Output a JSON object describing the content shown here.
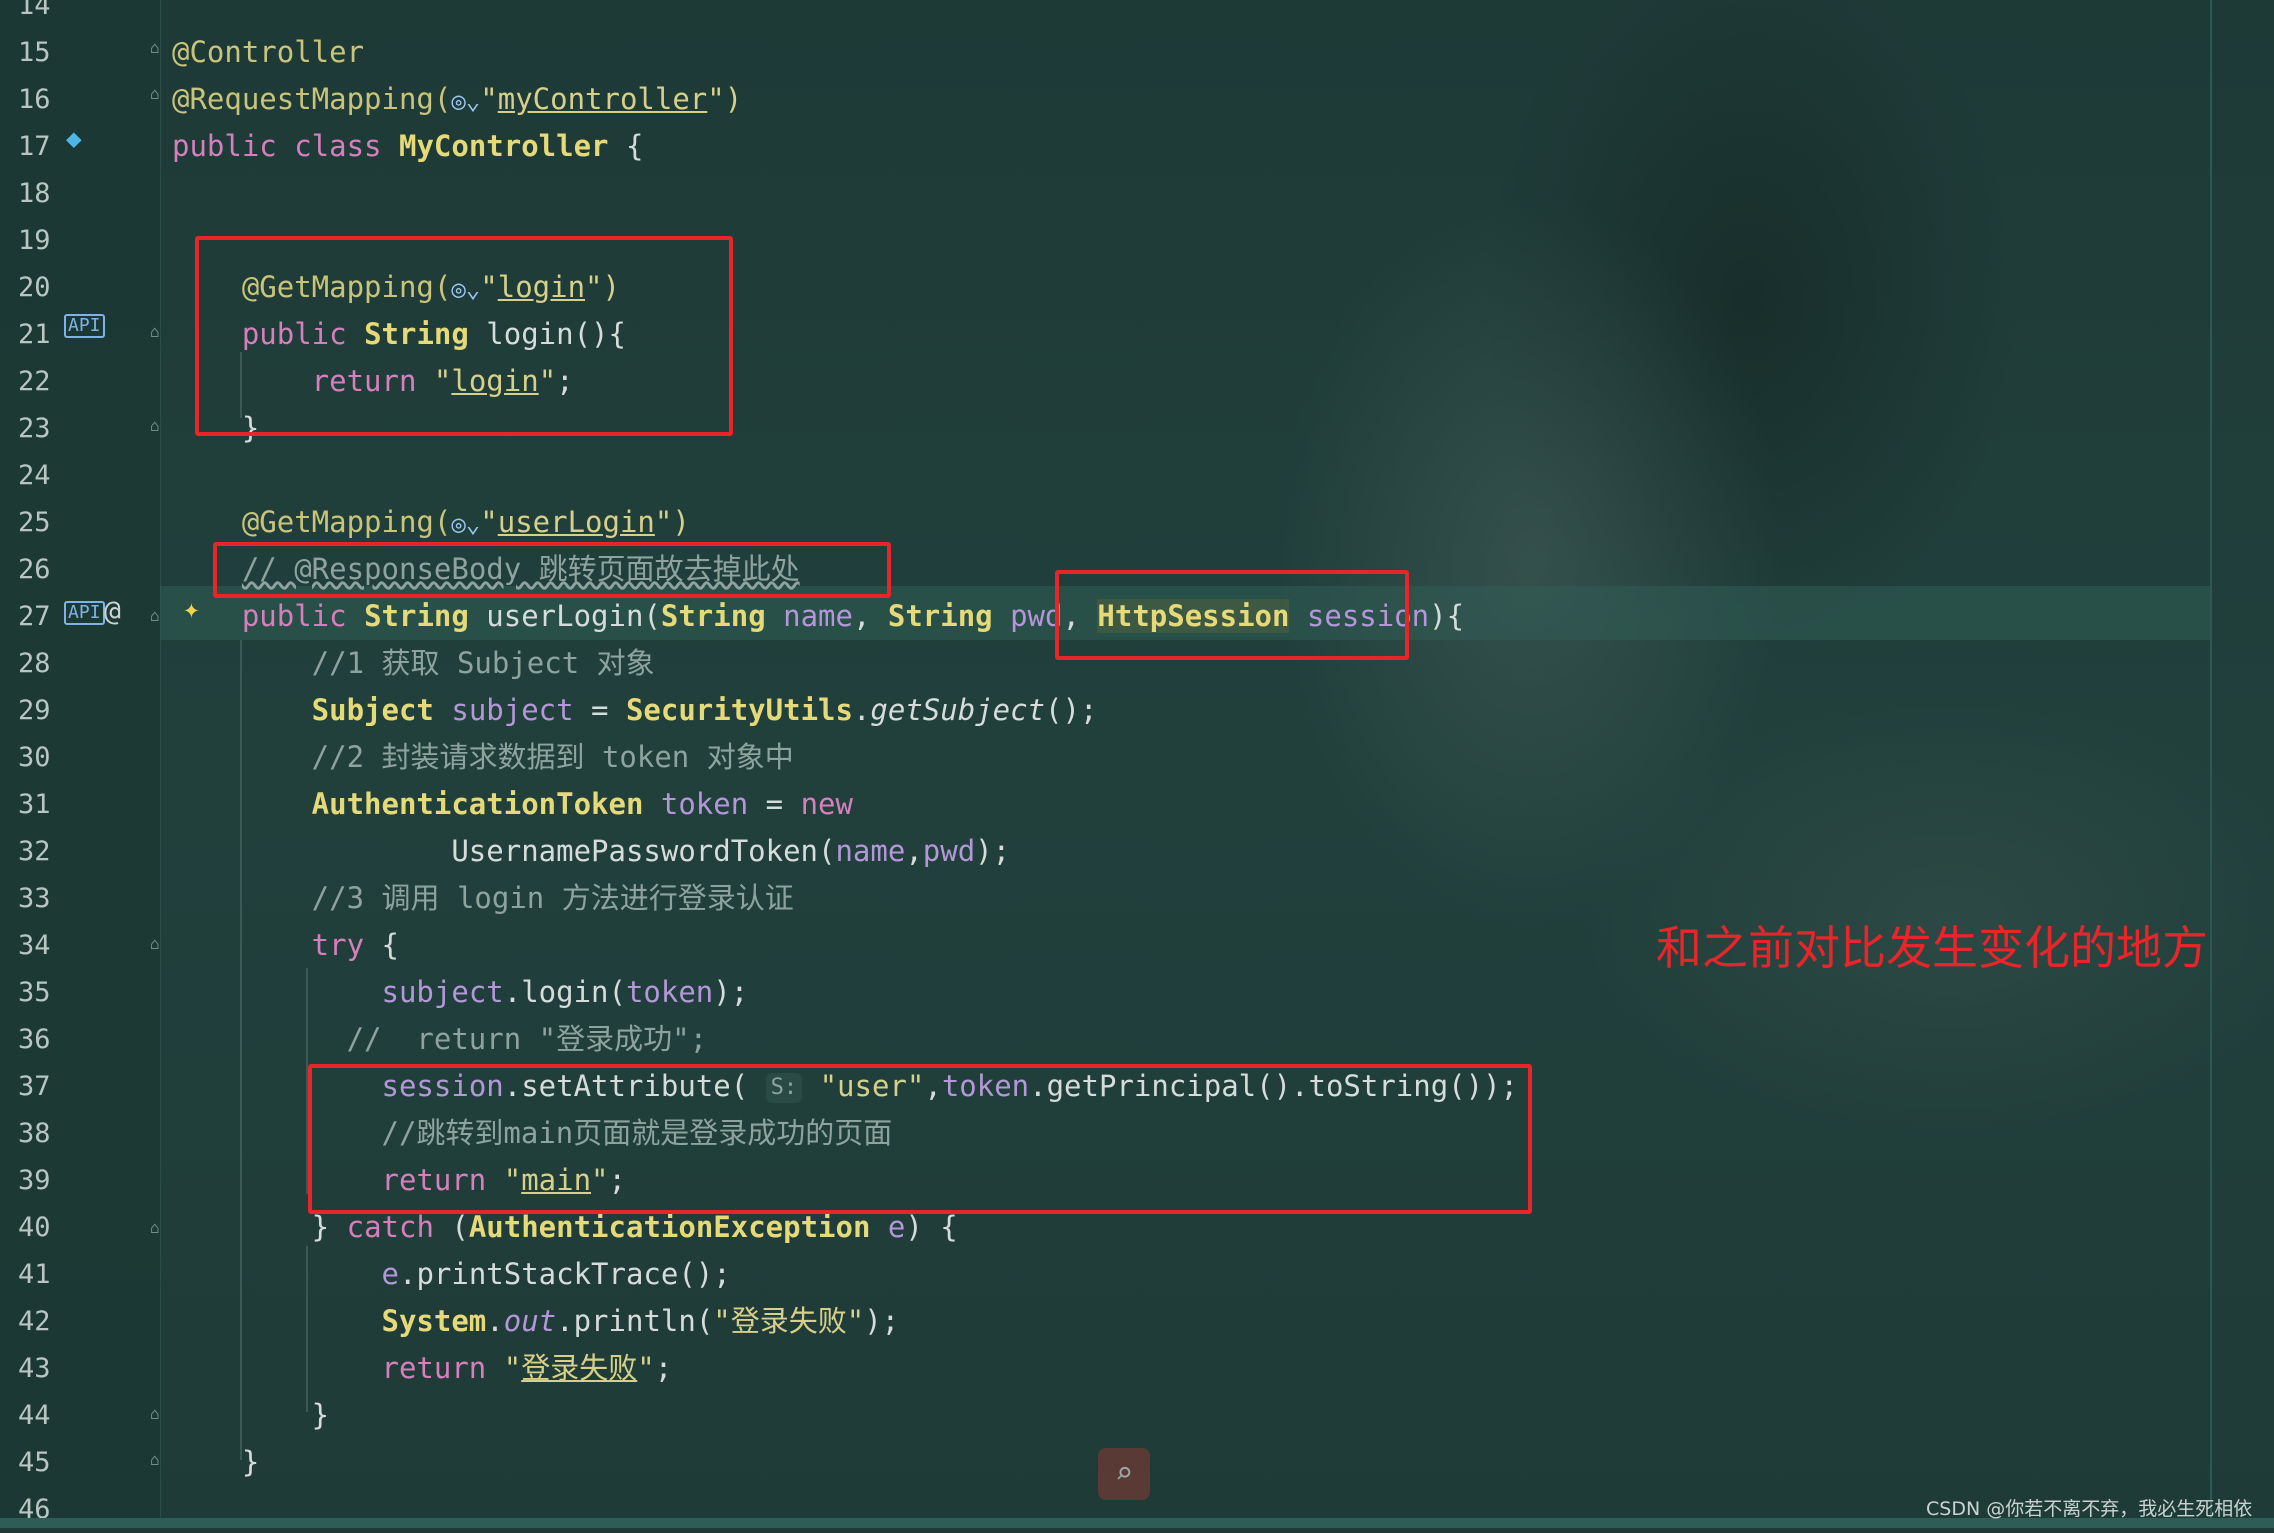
{
  "lines": [
    {
      "n": "14",
      "tokens": []
    },
    {
      "n": "15",
      "tokens": [
        {
          "t": "@Controller",
          "c": "annot"
        }
      ]
    },
    {
      "n": "16",
      "tokens": [
        {
          "t": "@RequestMapping(",
          "c": "annot"
        },
        {
          "t": "◎⌄",
          "c": "globe"
        },
        {
          "t": "\"",
          "c": "str"
        },
        {
          "t": "myController",
          "c": "strl"
        },
        {
          "t": "\")",
          "c": "str"
        }
      ]
    },
    {
      "n": "17",
      "tokens": [
        {
          "t": "public ",
          "c": "kw"
        },
        {
          "t": "class ",
          "c": "kw"
        },
        {
          "t": "MyController",
          "c": "cls"
        },
        {
          "t": " {",
          "c": "plain"
        }
      ]
    },
    {
      "n": "18",
      "tokens": []
    },
    {
      "n": "19",
      "tokens": []
    },
    {
      "n": "20",
      "tokens": [
        {
          "t": "    @GetMapping(",
          "c": "annot"
        },
        {
          "t": "◎⌄",
          "c": "globe"
        },
        {
          "t": "\"",
          "c": "str"
        },
        {
          "t": "login",
          "c": "strl"
        },
        {
          "t": "\")",
          "c": "str"
        }
      ]
    },
    {
      "n": "21",
      "tokens": [
        {
          "t": "    public ",
          "c": "kw"
        },
        {
          "t": "String ",
          "c": "cls"
        },
        {
          "t": "login(){",
          "c": "plain"
        }
      ]
    },
    {
      "n": "22",
      "tokens": [
        {
          "t": "        return ",
          "c": "kw"
        },
        {
          "t": "\"",
          "c": "str"
        },
        {
          "t": "login",
          "c": "strl"
        },
        {
          "t": "\"",
          "c": "str"
        },
        {
          "t": ";",
          "c": "plain"
        }
      ]
    },
    {
      "n": "23",
      "tokens": [
        {
          "t": "    }",
          "c": "plain"
        }
      ]
    },
    {
      "n": "24",
      "tokens": []
    },
    {
      "n": "25",
      "tokens": [
        {
          "t": "    @GetMapping(",
          "c": "annot"
        },
        {
          "t": "◎⌄",
          "c": "globe"
        },
        {
          "t": "\"",
          "c": "str"
        },
        {
          "t": "userLogin",
          "c": "strl"
        },
        {
          "t": "\")",
          "c": "str"
        }
      ]
    },
    {
      "n": "26",
      "tokens": [
        {
          "t": "    ",
          "c": "plain"
        },
        {
          "t": "// @ResponseBody 跳转页面故去掉此处",
          "c": "cmu"
        }
      ]
    },
    {
      "n": "27",
      "tokens": [
        {
          "t": "    public ",
          "c": "kw"
        },
        {
          "t": "String ",
          "c": "cls"
        },
        {
          "t": "userLogin(",
          "c": "plain"
        },
        {
          "t": "String ",
          "c": "cls"
        },
        {
          "t": "name",
          "c": "var"
        },
        {
          "t": ", ",
          "c": "plain"
        },
        {
          "t": "String ",
          "c": "cls"
        },
        {
          "t": "pwd",
          "c": "var"
        },
        {
          "t": ", ",
          "c": "plain"
        },
        {
          "t": "HttpSession",
          "c": "cls hlbox"
        },
        {
          "t": " session",
          "c": "var"
        },
        {
          "t": "){",
          "c": "plain"
        }
      ]
    },
    {
      "n": "28",
      "tokens": [
        {
          "t": "        //1 获取 Subject 对象",
          "c": "cm"
        }
      ]
    },
    {
      "n": "29",
      "tokens": [
        {
          "t": "        Subject ",
          "c": "cls"
        },
        {
          "t": "subject",
          "c": "var"
        },
        {
          "t": " = ",
          "c": "plain"
        },
        {
          "t": "SecurityUtils",
          "c": "cls"
        },
        {
          "t": ".",
          "c": "plain"
        },
        {
          "t": "getSubject",
          "c": "plain it"
        },
        {
          "t": "();",
          "c": "plain"
        }
      ]
    },
    {
      "n": "30",
      "tokens": [
        {
          "t": "        //2 封装请求数据到 token 对象中",
          "c": "cm"
        }
      ]
    },
    {
      "n": "31",
      "tokens": [
        {
          "t": "        AuthenticationToken ",
          "c": "cls"
        },
        {
          "t": "token",
          "c": "var"
        },
        {
          "t": " = ",
          "c": "plain"
        },
        {
          "t": "new",
          "c": "kw"
        }
      ]
    },
    {
      "n": "32",
      "tokens": [
        {
          "t": "                UsernamePasswordToken(",
          "c": "plain"
        },
        {
          "t": "name",
          "c": "var"
        },
        {
          "t": ",",
          "c": "plain"
        },
        {
          "t": "pwd",
          "c": "var"
        },
        {
          "t": ");",
          "c": "plain"
        }
      ]
    },
    {
      "n": "33",
      "tokens": [
        {
          "t": "        //3 调用 login 方法进行登录认证",
          "c": "cm"
        }
      ]
    },
    {
      "n": "34",
      "tokens": [
        {
          "t": "        try ",
          "c": "kw"
        },
        {
          "t": "{",
          "c": "plain"
        }
      ]
    },
    {
      "n": "35",
      "tokens": [
        {
          "t": "            ",
          "c": "plain"
        },
        {
          "t": "subject",
          "c": "var"
        },
        {
          "t": ".login(",
          "c": "plain"
        },
        {
          "t": "token",
          "c": "var"
        },
        {
          "t": ");",
          "c": "plain"
        }
      ]
    },
    {
      "n": "36",
      "tokens": [
        {
          "t": "          //  return \"登录成功\";",
          "c": "cm"
        }
      ]
    },
    {
      "n": "37",
      "tokens": [
        {
          "t": "            ",
          "c": "plain"
        },
        {
          "t": "session",
          "c": "var"
        },
        {
          "t": ".setAttribute( ",
          "c": "plain"
        },
        {
          "t": "S:",
          "c": "hint"
        },
        {
          "t": " \"user\"",
          "c": "str"
        },
        {
          "t": ",",
          "c": "plain"
        },
        {
          "t": "token",
          "c": "var"
        },
        {
          "t": ".getPrincipal().toString());",
          "c": "plain"
        }
      ]
    },
    {
      "n": "38",
      "tokens": [
        {
          "t": "            //跳转到main页面就是登录成功的页面",
          "c": "cm"
        }
      ]
    },
    {
      "n": "39",
      "tokens": [
        {
          "t": "            return ",
          "c": "kw"
        },
        {
          "t": "\"",
          "c": "str"
        },
        {
          "t": "main",
          "c": "strl"
        },
        {
          "t": "\"",
          "c": "str"
        },
        {
          "t": ";",
          "c": "plain"
        }
      ]
    },
    {
      "n": "40",
      "tokens": [
        {
          "t": "        } ",
          "c": "plain"
        },
        {
          "t": "catch ",
          "c": "kw"
        },
        {
          "t": "(",
          "c": "plain"
        },
        {
          "t": "AuthenticationException ",
          "c": "cls"
        },
        {
          "t": "e",
          "c": "var"
        },
        {
          "t": ") {",
          "c": "plain"
        }
      ]
    },
    {
      "n": "41",
      "tokens": [
        {
          "t": "            ",
          "c": "plain"
        },
        {
          "t": "e",
          "c": "var"
        },
        {
          "t": ".printStackTrace();",
          "c": "plain"
        }
      ]
    },
    {
      "n": "42",
      "tokens": [
        {
          "t": "            System",
          "c": "cls"
        },
        {
          "t": ".",
          "c": "plain"
        },
        {
          "t": "out",
          "c": "var it"
        },
        {
          "t": ".println(",
          "c": "plain"
        },
        {
          "t": "\"登录失败\"",
          "c": "str"
        },
        {
          "t": ");",
          "c": "plain"
        }
      ]
    },
    {
      "n": "43",
      "tokens": [
        {
          "t": "            return ",
          "c": "kw"
        },
        {
          "t": "\"",
          "c": "str"
        },
        {
          "t": "登录失败",
          "c": "strl"
        },
        {
          "t": "\"",
          "c": "str"
        },
        {
          "t": ";",
          "c": "plain"
        }
      ]
    },
    {
      "n": "44",
      "tokens": [
        {
          "t": "        }",
          "c": "plain"
        }
      ]
    },
    {
      "n": "45",
      "tokens": [
        {
          "t": "    }",
          "c": "plain"
        }
      ]
    },
    {
      "n": "46",
      "tokens": []
    }
  ],
  "annotation_note": "和之前对比发生变化的地方",
  "watermark": "CSDN @你若不离不弃，我必生死相依",
  "icons": {
    "line17": "bean-class-icon",
    "line21": "api-endpoint-icon",
    "line27": "api-endpoint-icon",
    "line27_at": "@",
    "line27_bulb": "lightbulb-icon",
    "search": "search-icon"
  },
  "colors": {
    "highlight_box": "#e8262a",
    "background": "#1f3a37"
  }
}
